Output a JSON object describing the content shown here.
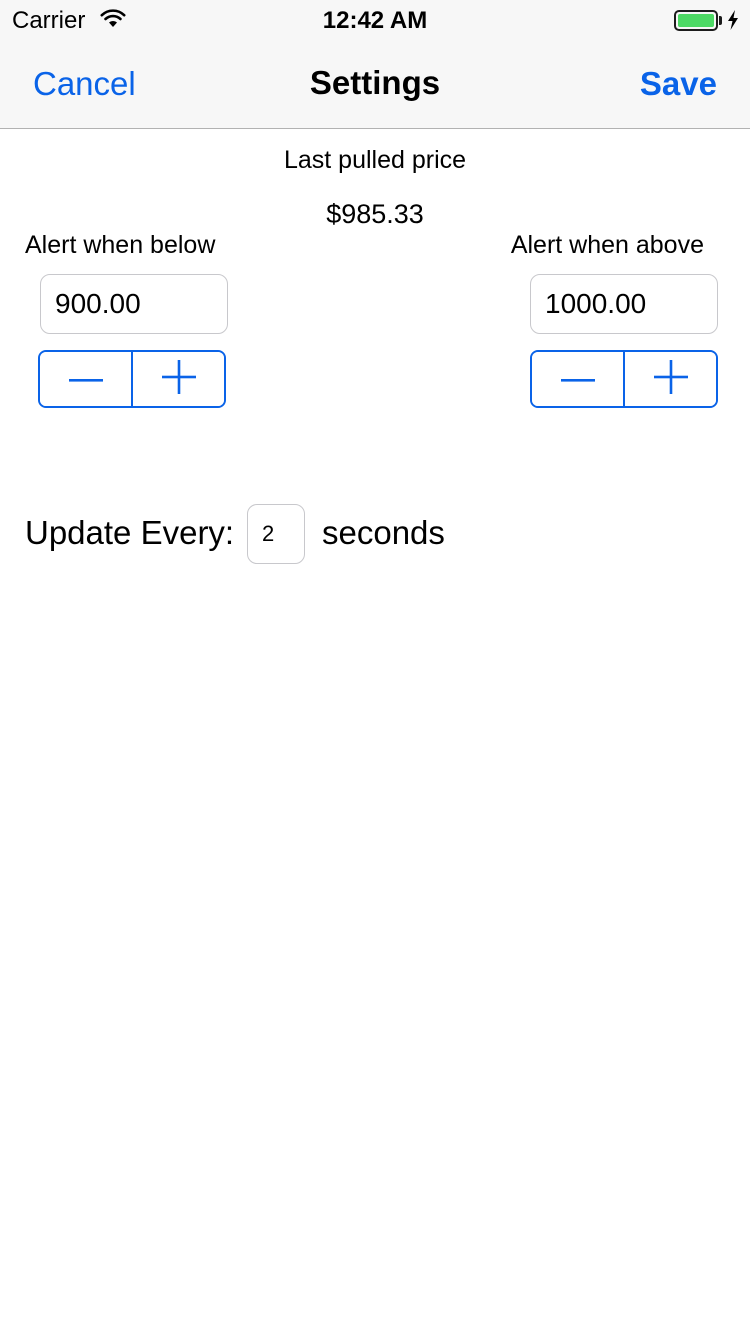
{
  "status_bar": {
    "carrier": "Carrier",
    "time": "12:42 AM",
    "battery_level": 1.0,
    "battery_color": "#4cd964",
    "icons": [
      "wifi-icon",
      "battery-icon",
      "charging-bolt-icon"
    ]
  },
  "nav": {
    "cancel_label": "Cancel",
    "title": "Settings",
    "save_label": "Save",
    "accent_color": "#0a63e8"
  },
  "price": {
    "label": "Last pulled price",
    "value": "$985.33"
  },
  "alert_below": {
    "label": "Alert when below",
    "value": "900.00"
  },
  "alert_above": {
    "label": "Alert when above",
    "value": "1000.00"
  },
  "stepper_icons": [
    "minus-icon",
    "plus-icon"
  ],
  "update": {
    "label": "Update Every:",
    "value": "2",
    "unit": "seconds"
  }
}
